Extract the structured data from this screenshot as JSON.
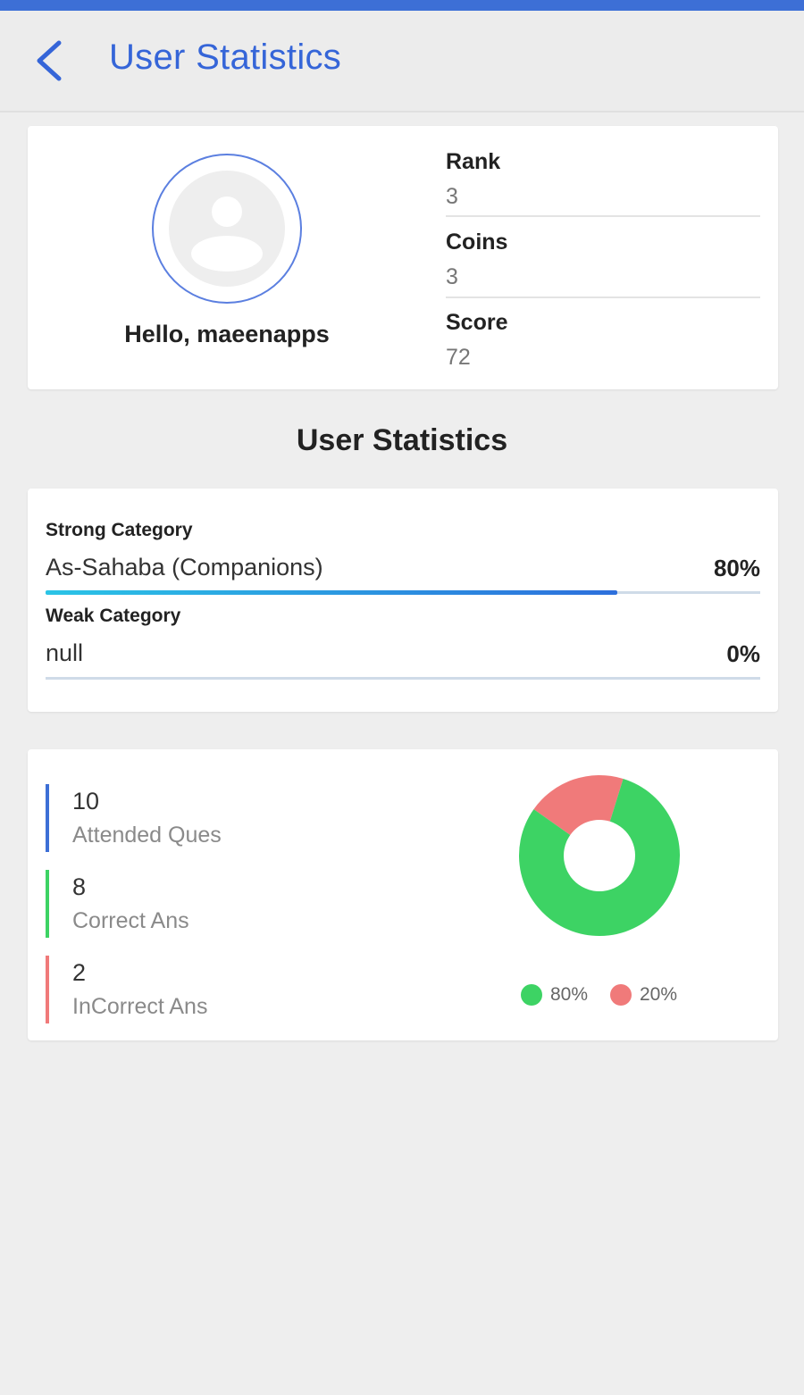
{
  "app_bar": {
    "title": "User Statistics",
    "back_icon": "chevron-left-icon",
    "accent": "#3565d8"
  },
  "profile": {
    "greeting": "Hello, maeenapps",
    "avatar_icon": "person-icon",
    "stats": [
      {
        "label": "Rank",
        "value": "3"
      },
      {
        "label": "Coins",
        "value": "3"
      },
      {
        "label": "Score",
        "value": "72"
      }
    ]
  },
  "section_heading": "User Statistics",
  "categories": {
    "strong": {
      "label": "Strong Category",
      "name": "As-Sahaba (Companions)",
      "percent_text": "80%",
      "progress": 0.8
    },
    "weak": {
      "label": "Weak Category",
      "name": "null",
      "percent_text": "0%",
      "progress": 0
    }
  },
  "answers": {
    "items": [
      {
        "count": "10",
        "label": "Attended Ques",
        "color": "#3d6fd6"
      },
      {
        "count": "8",
        "label": "Correct Ans",
        "color": "#3dd364"
      },
      {
        "count": "2",
        "label": "InCorrect Ans",
        "color": "#f07a7a"
      }
    ]
  },
  "chart_data": {
    "type": "pie",
    "donut": true,
    "categories": [
      "Correct",
      "Incorrect"
    ],
    "values": [
      80,
      20
    ],
    "colors": [
      "#3dd364",
      "#f07a7a"
    ],
    "legend": [
      "80%",
      "20%"
    ],
    "legend_position": "bottom"
  }
}
